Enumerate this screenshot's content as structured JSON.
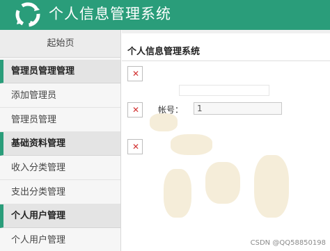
{
  "header": {
    "app_title": "个人信息管理系统",
    "brand_color": "#2a9d7a"
  },
  "sidebar": {
    "home_tab": "起始页",
    "sections": [
      {
        "label": "管理员管理管理",
        "items": [
          "添加管理员",
          "管理员管理"
        ]
      },
      {
        "label": "基础资料管理",
        "items": [
          "收入分类管理",
          "支出分类管理"
        ]
      },
      {
        "label": "个人用户管理",
        "items": [
          "个人用户管理"
        ]
      }
    ]
  },
  "main": {
    "page_title": "个人信息管理系统",
    "account_label": "帐号：",
    "account_value": "1",
    "broken_image_icon": "broken-image-icon"
  },
  "watermark": "CSDN @QQ58850198"
}
